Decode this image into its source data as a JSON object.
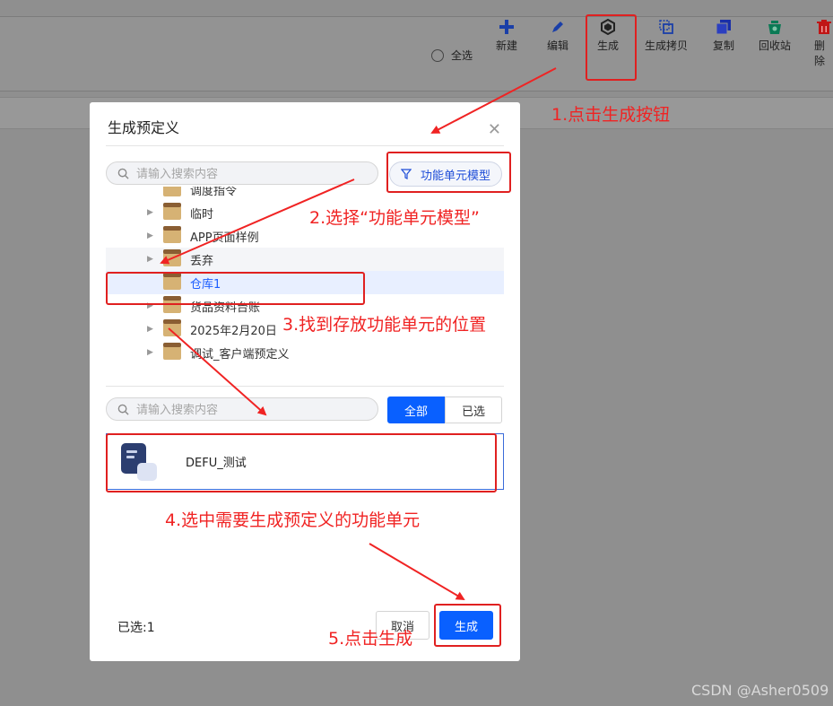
{
  "toolbar": {
    "select_all": "全选",
    "items": [
      {
        "label": "新建",
        "icon": "plus-icon",
        "color": "#1a3fa8"
      },
      {
        "label": "编辑",
        "icon": "pencil-icon",
        "color": "#1a3fa8"
      },
      {
        "label": "生成",
        "icon": "generate-icon",
        "color": "#222222"
      },
      {
        "label": "生成拷贝",
        "icon": "copy-generate-icon",
        "color": "#1a3fa8"
      },
      {
        "label": "复制",
        "icon": "duplicate-icon",
        "color": "#1a2fa8"
      },
      {
        "label": "回收站",
        "icon": "recycle-bin-icon",
        "color": "#0a7a55"
      },
      {
        "label": "删除",
        "icon": "trash-icon",
        "color": "#c01515"
      }
    ]
  },
  "dialog": {
    "title": "生成预定义",
    "close_icon": "close-icon",
    "tree_search_placeholder": "请输入搜索内容",
    "filter_label": "功能单元模型",
    "tree": [
      {
        "label": "调度指令",
        "expandable": false
      },
      {
        "label": "临时",
        "expandable": true
      },
      {
        "label": "APP页面样例",
        "expandable": true
      },
      {
        "label": "丢弃",
        "expandable": true
      },
      {
        "label": "仓库1",
        "expandable": false,
        "selected": true
      },
      {
        "label": "货品资料台账",
        "expandable": true
      },
      {
        "label": "2025年2月20日",
        "expandable": true
      },
      {
        "label": "调试_客户端预定义",
        "expandable": true
      }
    ],
    "list_search_placeholder": "请输入搜索内容",
    "segment": {
      "all": "全部",
      "selected": "已选"
    },
    "items": [
      {
        "label": "DEFU_测试"
      }
    ],
    "selected_count": "已选:1",
    "cancel_label": "取消",
    "generate_label": "生成"
  },
  "annotations": {
    "step1": "1.点击生成按钮",
    "step2": "2.选择“功能单元模型”",
    "step3": "3.找到存放功能单元的位置",
    "step4": "4.选中需要生成预定义的功能单元",
    "step5": "5.点击生成"
  },
  "watermark": "CSDN @Asher0509",
  "colors": {
    "primary": "#0960ff",
    "annotation": "#f02323",
    "overlay": "#8f8f8f"
  }
}
